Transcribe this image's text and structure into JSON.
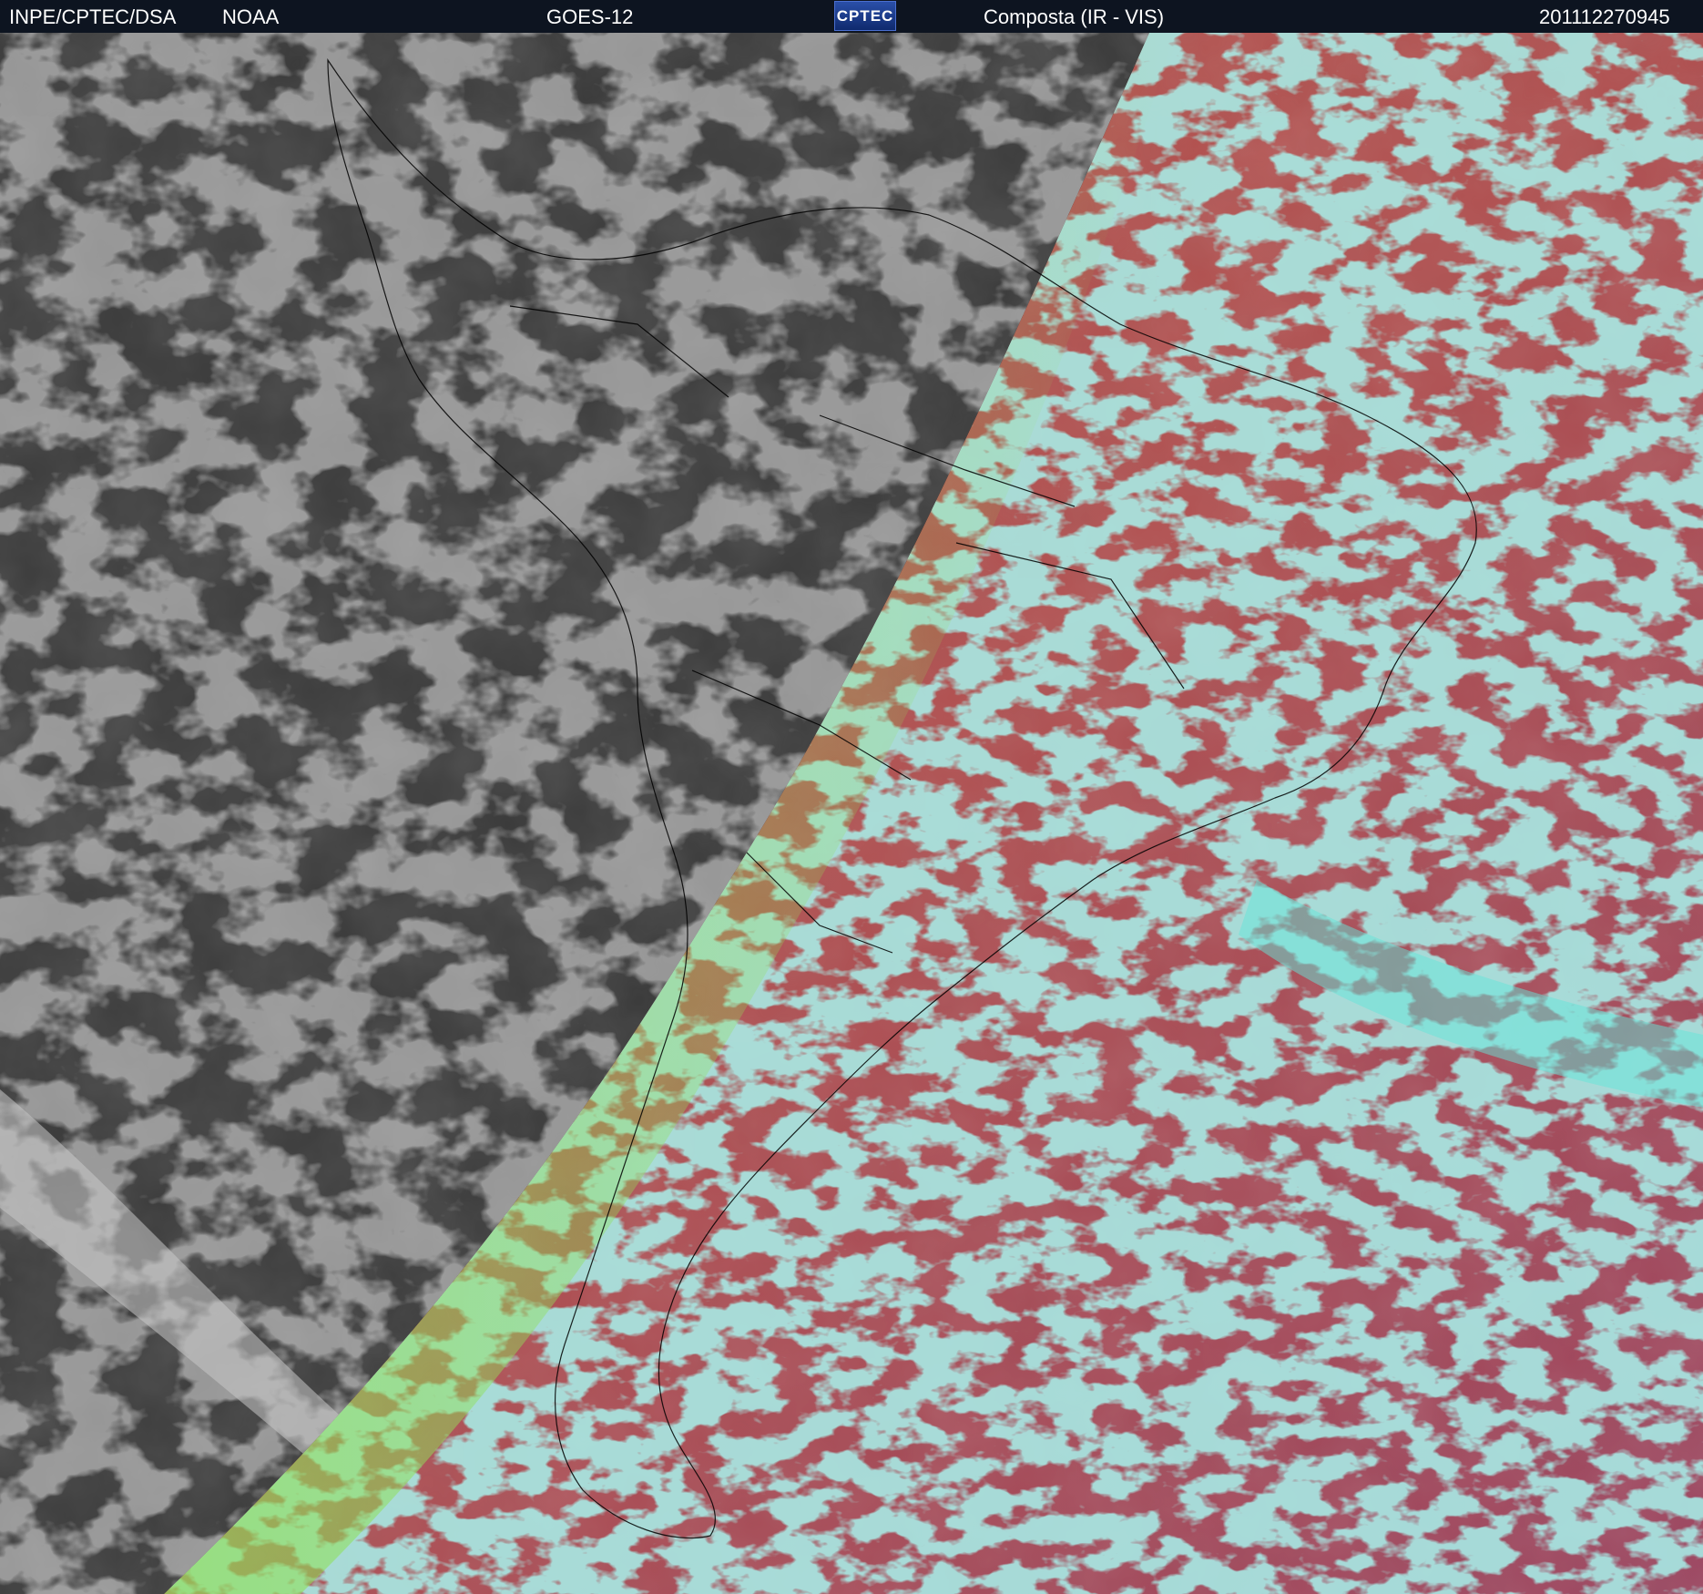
{
  "header": {
    "agency": "INPE/CPTEC/DSA",
    "provider": "NOAA",
    "satellite": "GOES-12",
    "logo_text": "CPTEC",
    "product": "Composta (IR - VIS)",
    "timestamp": "201112270945"
  },
  "image": {
    "night_side_color": "#3a3a3a",
    "day_side_color": "#b2524a",
    "cloud_color_day": "#63e6d9",
    "terminator_color": "#8fe05a",
    "coastline_color": "#000000"
  }
}
